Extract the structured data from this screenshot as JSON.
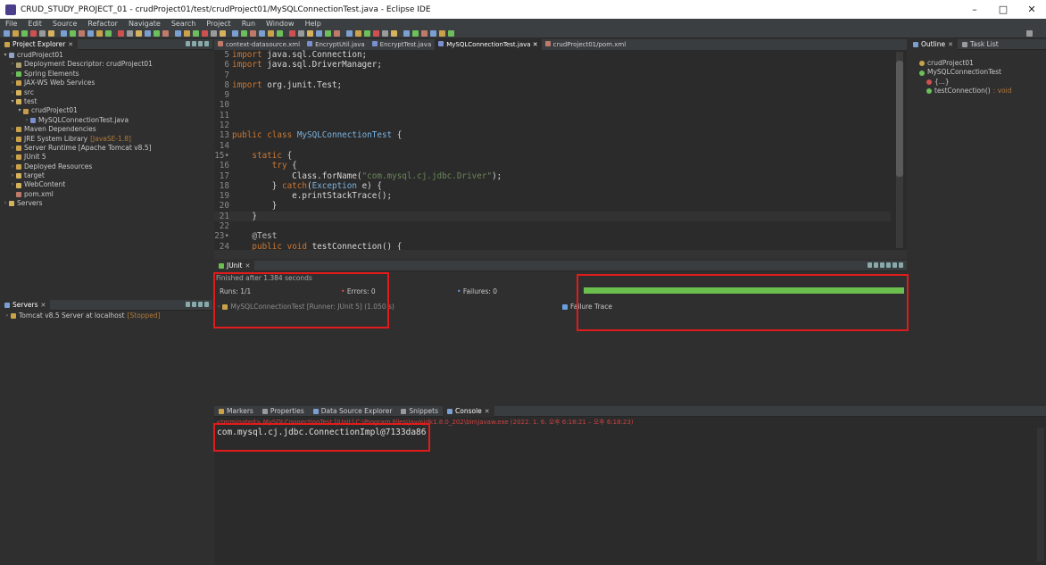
{
  "window": {
    "title": "CRUD_STUDY_PROJECT_01 - crudProject01/test/crudProject01/MySQLConnectionTest.java - Eclipse IDE",
    "minimize": "–",
    "maximize": "□",
    "close": "✕"
  },
  "menu": [
    "File",
    "Edit",
    "Source",
    "Refactor",
    "Navigate",
    "Search",
    "Project",
    "Run",
    "Window",
    "Help"
  ],
  "explorer": {
    "tab_label": "Project Explorer",
    "items": [
      {
        "label": "crudProject01",
        "arrow": "▾",
        "indent": 0,
        "icon_color": "#8fa3c8"
      },
      {
        "label": "Deployment Descriptor: crudProject01",
        "arrow": "›",
        "indent": 1,
        "icon_color": "#b0a070"
      },
      {
        "label": "Spring Elements",
        "arrow": "›",
        "indent": 1,
        "icon_color": "#6cbf5a"
      },
      {
        "label": "JAX-WS Web Services",
        "arrow": "›",
        "indent": 1,
        "icon_color": "#c9a24a"
      },
      {
        "label": "src",
        "arrow": "›",
        "indent": 1,
        "icon_color": "#d6b25c"
      },
      {
        "label": "test",
        "arrow": "▾",
        "indent": 1,
        "icon_color": "#d6b25c"
      },
      {
        "label": "crudProject01",
        "arrow": "▾",
        "indent": 2,
        "icon_color": "#c89a4a"
      },
      {
        "label": "MySQLConnectionTest.java",
        "arrow": "›",
        "indent": 3,
        "icon_color": "#7a8fd0"
      },
      {
        "label": "Maven Dependencies",
        "arrow": "›",
        "indent": 1,
        "icon_color": "#c9a24a"
      },
      {
        "label": "JRE System Library",
        "extra": "[JavaSE-1.8]",
        "arrow": "›",
        "indent": 1,
        "icon_color": "#c9a24a"
      },
      {
        "label": "Server Runtime [Apache Tomcat v8.5]",
        "arrow": "›",
        "indent": 1,
        "icon_color": "#c9a24a"
      },
      {
        "label": "JUnit 5",
        "arrow": "›",
        "indent": 1,
        "icon_color": "#c9a24a"
      },
      {
        "label": "Deployed Resources",
        "arrow": "›",
        "indent": 1,
        "icon_color": "#c9a24a"
      },
      {
        "label": "target",
        "arrow": "›",
        "indent": 1,
        "icon_color": "#d6b25c"
      },
      {
        "label": "WebContent",
        "arrow": "›",
        "indent": 1,
        "icon_color": "#d6b25c"
      },
      {
        "label": "pom.xml",
        "arrow": "",
        "indent": 1,
        "icon_color": "#c07a6a"
      },
      {
        "label": "Servers",
        "arrow": "›",
        "indent": 0,
        "icon_color": "#d6b25c"
      }
    ]
  },
  "servers_view": {
    "tab_label": "Servers",
    "server_label": "Tomcat v8.5 Server at localhost",
    "server_state": "[Stopped]"
  },
  "editor": {
    "tabs": [
      "context-datasource.xml",
      "EncryptUtil.java",
      "EncryptTest.java",
      "MySQLConnectionTest.java",
      "crudProject01/pom.xml"
    ],
    "active_tab": "MySQLConnectionTest.java",
    "lines": [
      {
        "n": "5",
        "t": "import java.sql.Connection;"
      },
      {
        "n": "6",
        "t": "import java.sql.DriverManager;"
      },
      {
        "n": "7",
        "t": ""
      },
      {
        "n": "8",
        "t": "import org.junit.Test;"
      },
      {
        "n": "9",
        "t": ""
      },
      {
        "n": "10",
        "t": ""
      },
      {
        "n": "11",
        "t": ""
      },
      {
        "n": "12",
        "t": ""
      },
      {
        "n": "13",
        "t": "public class MySQLConnectionTest {"
      },
      {
        "n": "14",
        "t": ""
      },
      {
        "n": "15•",
        "t": "    static {"
      },
      {
        "n": "16",
        "t": "        try {"
      },
      {
        "n": "17",
        "t": "            Class.forName(\"com.mysql.cj.jdbc.Driver\");"
      },
      {
        "n": "18",
        "t": "        } catch(Exception e) {"
      },
      {
        "n": "19",
        "t": "            e.printStackTrace();"
      },
      {
        "n": "20",
        "t": "        }"
      },
      {
        "n": "21",
        "t": "    }"
      },
      {
        "n": "22",
        "t": ""
      },
      {
        "n": "23•",
        "t": "    @Test"
      },
      {
        "n": "24",
        "t": "    public void testConnection() {"
      }
    ]
  },
  "outline": {
    "tab_label": "Outline",
    "tab2_label": "Task List",
    "items": [
      {
        "label": "crudProject01",
        "indent": 1
      },
      {
        "label": "MySQLConnectionTest",
        "indent": 1
      },
      {
        "label": "{...}",
        "indent": 2
      },
      {
        "label": "testConnection()",
        "extra": ": void",
        "indent": 2
      }
    ]
  },
  "junit": {
    "tab_label": "JUnit",
    "finished": "Finished after 1.384 seconds",
    "runs": "Runs: 1/1",
    "errors": "Errors: 0",
    "failures": "Failures: 0",
    "progress": 1.0,
    "test_row": "MySQLConnectionTest [Runner: JUnit 5] (1.050 s)",
    "failure_trace": "Failure Trace"
  },
  "console": {
    "tabs": [
      "Markers",
      "Properties",
      "Data Source Explorer",
      "Snippets",
      "Console"
    ],
    "terminated_label": "<terminated> MySQLConnectionTest [JUnit] C:\\Program Files\\Java\\jdk1.8.0_202\\bin\\javaw.exe  (2022. 1. 6. 오후 6:18:21 – 오후 6:18:23)",
    "output": "com.mysql.cj.jdbc.ConnectionImpl@7133da86"
  },
  "colors": {
    "junit_success": "#6bbf4e",
    "highlight_box": "#e11b1b",
    "background": "#2f2f2f"
  }
}
